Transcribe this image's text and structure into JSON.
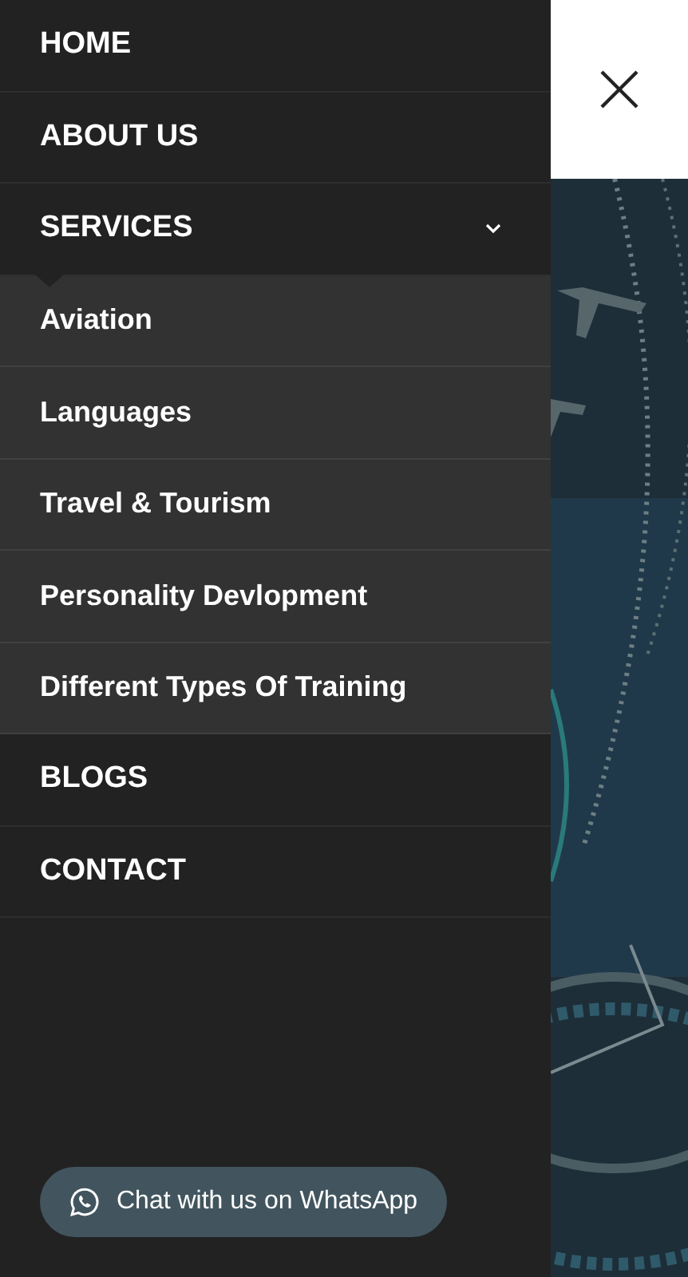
{
  "menu": {
    "items": [
      {
        "label": "HOME"
      },
      {
        "label": "ABOUT US"
      },
      {
        "label": "SERVICES",
        "expanded": true,
        "children": [
          {
            "label": "Aviation"
          },
          {
            "label": "Languages"
          },
          {
            "label": "Travel & Tourism"
          },
          {
            "label": "Personality Devlopment"
          },
          {
            "label": "Different Types Of Training"
          }
        ]
      },
      {
        "label": "BLOGS"
      },
      {
        "label": "CONTACT"
      }
    ]
  },
  "whatsapp_button": {
    "label": "Chat with us on WhatsApp"
  }
}
